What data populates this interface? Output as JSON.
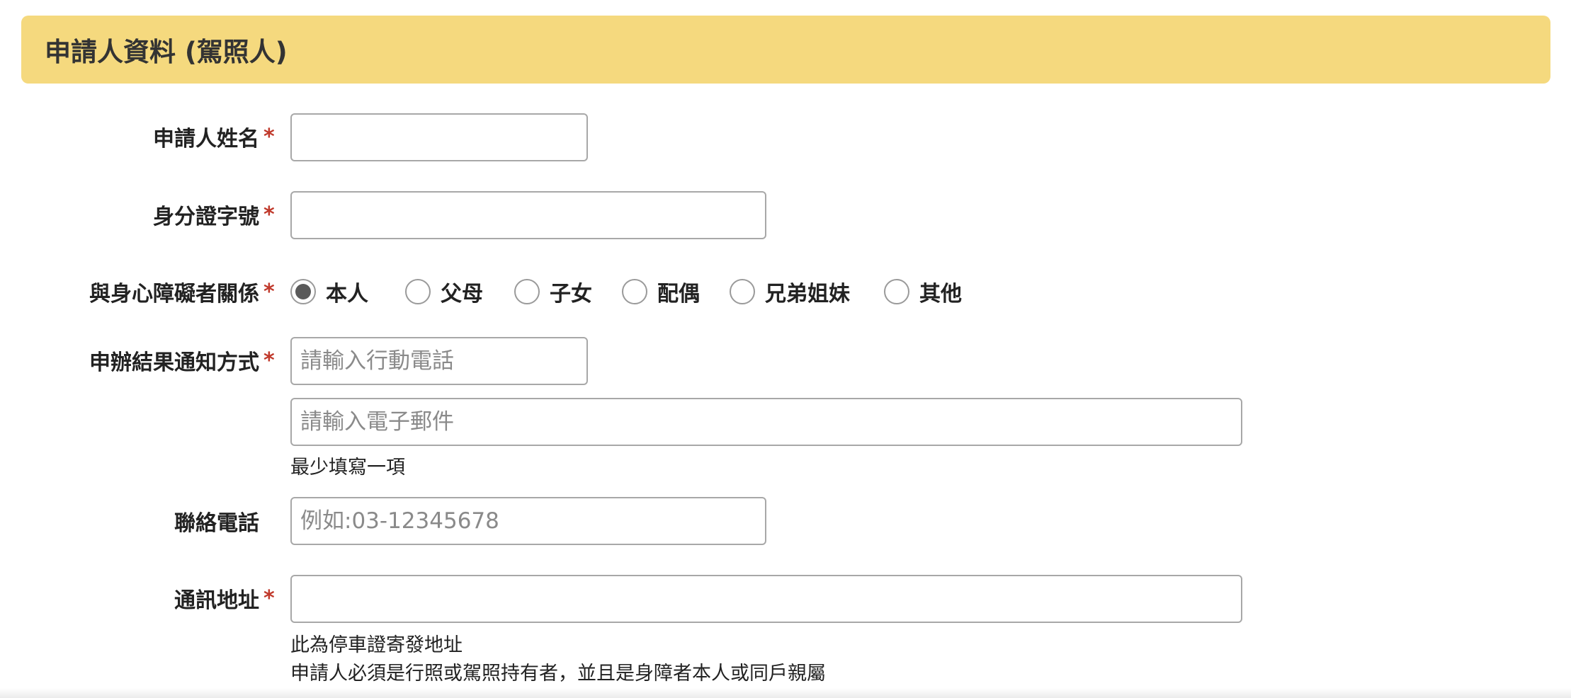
{
  "section": {
    "title": "申請人資料 (駕照人)"
  },
  "fields": {
    "name": {
      "label": "申請人姓名",
      "required": "*",
      "value": "",
      "placeholder": ""
    },
    "id_number": {
      "label": "身分證字號",
      "required": "*",
      "value": "",
      "placeholder": ""
    },
    "relationship": {
      "label": "與身心障礙者關係",
      "required": "*",
      "options": [
        "本人",
        "父母",
        "子女",
        "配偶",
        "兄弟姐妹",
        "其他"
      ],
      "selected": "本人"
    },
    "notify": {
      "label": "申辦結果通知方式",
      "required": "*",
      "mobile_placeholder": "請輸入行動電話",
      "email_placeholder": "請輸入電子郵件",
      "hint": "最少填寫一項"
    },
    "contact_phone": {
      "label": "聯絡電話",
      "placeholder": "例如:03-12345678"
    },
    "address": {
      "label": "通訊地址",
      "required": "*",
      "value": "",
      "hint1": "此為停車證寄發地址",
      "hint2": "申請人必須是行照或駕照持有者，並且是身障者本人或同戶親屬"
    }
  },
  "colors": {
    "header_bg": "#f5d97e",
    "required_mark": "#c0392b",
    "input_border": "#a8a8a8"
  }
}
